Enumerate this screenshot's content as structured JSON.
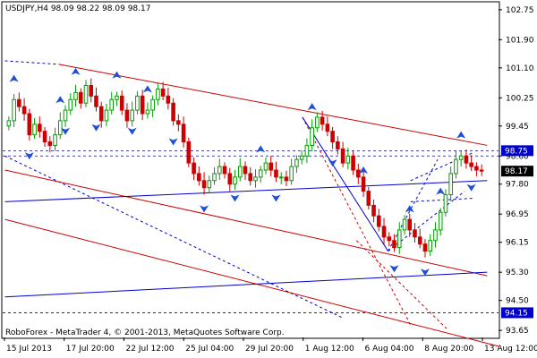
{
  "header": {
    "symbol_line": "USDJPY,H4  98.09 98.22 98.09 98.17"
  },
  "footer": {
    "copyright": "RoboForex - MetaTrader 4, © 2001-2013, MetaQuotes Software Corp."
  },
  "chart_data": {
    "type": "candlestick",
    "symbol": "USDJPY",
    "timeframe": "H4",
    "ohlc_header": {
      "open": 98.09,
      "high": 98.22,
      "low": 98.09,
      "close": 98.17
    },
    "y_ticks": [
      102.75,
      101.9,
      101.1,
      100.25,
      99.45,
      98.6,
      97.8,
      96.95,
      96.15,
      95.3,
      94.5,
      93.65
    ],
    "ylim": [
      93.45,
      102.95
    ],
    "x_ticks": [
      "15 Jul 2013",
      "17 Jul 20:00",
      "22 Jul 12:00",
      "25 Jul 04:00",
      "29 Jul 20:00",
      "1 Aug 12:00",
      "6 Aug 04:00",
      "8 Aug 20:00",
      "13 Aug 12:00"
    ],
    "price_marks": [
      {
        "value": 98.75,
        "style": "level"
      },
      {
        "value": 98.17,
        "style": "current"
      },
      {
        "value": 94.15,
        "style": "level"
      }
    ],
    "horizontal_levels": [
      98.75,
      98.6,
      94.15
    ],
    "close_path": [
      99.6,
      100.2,
      100.0,
      99.8,
      99.2,
      99.5,
      99.3,
      99.0,
      98.9,
      99.2,
      99.6,
      99.9,
      100.2,
      100.4,
      100.1,
      100.6,
      100.3,
      100.0,
      99.6,
      99.9,
      100.2,
      100.3,
      99.9,
      99.6,
      99.9,
      100.3,
      99.8,
      99.9,
      100.2,
      100.5,
      100.3,
      100.1,
      99.6,
      99.5,
      99.0,
      98.4,
      98.1,
      97.9,
      97.7,
      97.9,
      98.1,
      98.3,
      98.1,
      97.8,
      98.0,
      98.3,
      98.1,
      97.9,
      98.0,
      98.2,
      98.4,
      98.2,
      98.0,
      98.0,
      97.9,
      98.3,
      98.5,
      98.6,
      98.9,
      99.4,
      99.7,
      99.5,
      99.3,
      99.0,
      98.8,
      98.4,
      98.6,
      98.2,
      98.0,
      97.6,
      97.2,
      96.9,
      96.6,
      96.3,
      96.2,
      96.0,
      96.5,
      96.8,
      96.5,
      96.3,
      96.1,
      95.9,
      96.2,
      96.5,
      97.0,
      97.5,
      98.1,
      98.5,
      98.6,
      98.4,
      98.3,
      98.2,
      98.17
    ],
    "arrows": [
      {
        "bar": 1,
        "dir": "up"
      },
      {
        "bar": 4,
        "dir": "down"
      },
      {
        "bar": 10,
        "dir": "up"
      },
      {
        "bar": 11,
        "dir": "down"
      },
      {
        "bar": 13,
        "dir": "up"
      },
      {
        "bar": 17,
        "dir": "down"
      },
      {
        "bar": 21,
        "dir": "up"
      },
      {
        "bar": 24,
        "dir": "down"
      },
      {
        "bar": 27,
        "dir": "up"
      },
      {
        "bar": 32,
        "dir": "down"
      },
      {
        "bar": 38,
        "dir": "down"
      },
      {
        "bar": 44,
        "dir": "down"
      },
      {
        "bar": 49,
        "dir": "up"
      },
      {
        "bar": 52,
        "dir": "down"
      },
      {
        "bar": 59,
        "dir": "up"
      },
      {
        "bar": 63,
        "dir": "down"
      },
      {
        "bar": 69,
        "dir": "up"
      },
      {
        "bar": 75,
        "dir": "down"
      },
      {
        "bar": 78,
        "dir": "up"
      },
      {
        "bar": 81,
        "dir": "down"
      },
      {
        "bar": 84,
        "dir": "up"
      },
      {
        "bar": 88,
        "dir": "up"
      },
      {
        "bar": 90,
        "dir": "down"
      }
    ],
    "trendlines": [
      {
        "from": [
          0,
          101.3
        ],
        "to": [
          12,
          101.2
        ],
        "color": "#0000cc",
        "dash": true
      },
      {
        "from": [
          12,
          101.2
        ],
        "to": [
          107,
          98.9
        ],
        "color": "#cc0000",
        "dash": false
      },
      {
        "from": [
          0,
          98.2
        ],
        "to": [
          107,
          95.2
        ],
        "color": "#cc0000",
        "dash": false
      },
      {
        "from": [
          0,
          96.8
        ],
        "to": [
          110,
          93.2
        ],
        "color": "#cc0000",
        "dash": false
      },
      {
        "from": [
          0,
          97.3
        ],
        "to": [
          107,
          97.9
        ],
        "color": "#0000cc",
        "dash": false
      },
      {
        "from": [
          0,
          94.6
        ],
        "to": [
          107,
          95.3
        ],
        "color": "#0000cc",
        "dash": false
      },
      {
        "from": [
          0,
          98.6
        ],
        "to": [
          75,
          94.0
        ],
        "color": "#0000cc",
        "dash": true
      },
      {
        "from": [
          66,
          99.7
        ],
        "to": [
          90,
          93.8
        ],
        "color": "#cc0000",
        "dash": true
      },
      {
        "from": [
          78,
          96.2
        ],
        "to": [
          98,
          93.7
        ],
        "color": "#cc0000",
        "dash": true
      },
      {
        "from": [
          66,
          99.7
        ],
        "to": [
          85,
          95.9
        ],
        "color": "#0000cc",
        "dash": false
      },
      {
        "from": [
          85,
          95.9
        ],
        "to": [
          96,
          98.5
        ],
        "color": "#0000cc",
        "dash": true
      },
      {
        "from": [
          85,
          95.9
        ],
        "to": [
          102,
          97.6
        ],
        "color": "#0000cc",
        "dash": true
      },
      {
        "from": [
          90,
          97.9
        ],
        "to": [
          104,
          98.7
        ],
        "color": "#0000cc",
        "dash": true
      },
      {
        "from": [
          90,
          97.3
        ],
        "to": [
          104,
          97.4
        ],
        "color": "#0000cc",
        "dash": true
      }
    ],
    "colors": {
      "bull": "#00a000",
      "bear": "#cc0000",
      "arrow": "#1f4fd6",
      "level": "#0000cc",
      "axis_bg": "#ffffff",
      "current_box": "#000000"
    }
  }
}
